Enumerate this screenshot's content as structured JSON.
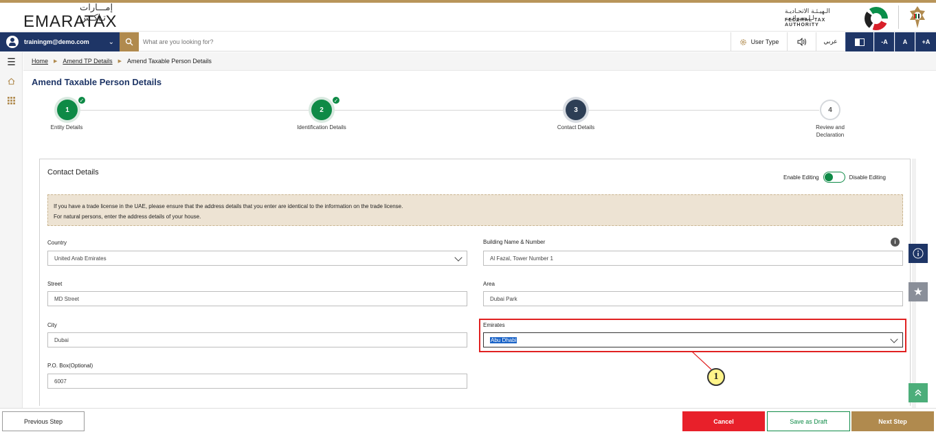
{
  "header": {
    "logo_ar": "إمـــارات تـاكـس",
    "logo_en": "EMARATAX",
    "fta_ar": "الـهيـئـة الاتحـاديـة لـلـضـرائـب",
    "fta_en": "FEDERAL TAX AUTHORITY"
  },
  "toolbar": {
    "user_email": "trainingm@demo.com",
    "search_placeholder": "What are you looking for?",
    "user_type": "User Type",
    "arabic": "عربي",
    "font_minus": "-A",
    "font_normal": "A",
    "font_plus": "+A"
  },
  "breadcrumb": {
    "home": "Home",
    "amend": "Amend TP Details",
    "current": "Amend Taxable Person Details"
  },
  "page_title": "Amend Taxable Person Details",
  "steps": [
    {
      "number": "1",
      "label": "Entity Details",
      "state": "done"
    },
    {
      "number": "2",
      "label": "Identification Details",
      "state": "done"
    },
    {
      "number": "3",
      "label": "Contact Details",
      "state": "active"
    },
    {
      "number": "4",
      "label": "Review and Declaration",
      "state": "todo"
    }
  ],
  "section": {
    "title": "Contact Details",
    "enable_editing": "Enable Editing",
    "disable_editing": "Disable Editing",
    "notice_line1": "If you have a trade license in the UAE, please ensure that the address details that you enter are identical to the information on the trade license.",
    "notice_line2": "For natural persons, enter the address details of your house."
  },
  "fields": {
    "country_label": "Country",
    "country_value": "United Arab Emirates",
    "building_label": "Building Name & Number",
    "building_value": "Al Fazal, Tower Number 1",
    "street_label": "Street",
    "street_value": "MD Street",
    "area_label": "Area",
    "area_value": "Dubai Park",
    "city_label": "City",
    "city_value": "Dubai",
    "emirates_label": "Emirates",
    "emirates_value": "Abu Dhabi",
    "pobox_label": "P.O. Box(Optional)",
    "pobox_value": "6007"
  },
  "callout_number": "1",
  "footer": {
    "previous": "Previous Step",
    "cancel": "Cancel",
    "save_draft": "Save as Draft",
    "next": "Next Step"
  },
  "colors": {
    "navy": "#1e3566",
    "gold": "#b08a4e",
    "green": "#0e8a46",
    "red": "#e8202a"
  }
}
